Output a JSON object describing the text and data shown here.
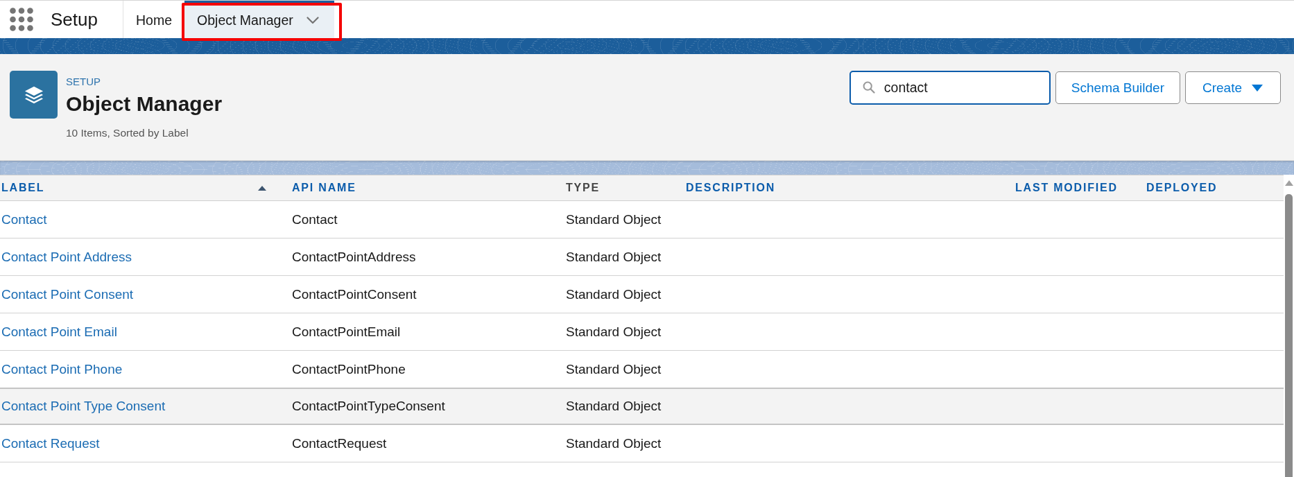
{
  "app_bar": {
    "app_name": "Setup",
    "tabs": [
      {
        "label": "Home",
        "selected": false,
        "has_menu": false,
        "annotated": false
      },
      {
        "label": "Object Manager",
        "selected": true,
        "has_menu": true,
        "annotated": true
      }
    ]
  },
  "page_header": {
    "breadcrumb": "SETUP",
    "title": "Object Manager",
    "summary": "10 Items, Sorted by Label",
    "search": {
      "value": "contact"
    },
    "buttons": [
      {
        "label": "Schema Builder",
        "kind": "plain"
      },
      {
        "label": "Create",
        "kind": "dropdown"
      }
    ]
  },
  "table": {
    "columns": [
      {
        "label": "LABEL",
        "sortable": true,
        "sorted": true
      },
      {
        "label": "API NAME",
        "sortable": true,
        "sorted": false
      },
      {
        "label": "TYPE",
        "sortable": false,
        "sorted": false
      },
      {
        "label": "DESCRIPTION",
        "sortable": true,
        "sorted": false
      },
      {
        "label": "LAST MODIFIED",
        "sortable": true,
        "sorted": false
      },
      {
        "label": "DEPLOYED",
        "sortable": true,
        "sorted": false
      }
    ],
    "rows": [
      {
        "label": "Contact",
        "api_name": "Contact",
        "type": "Standard Object",
        "hovered": false
      },
      {
        "label": "Contact Point Address",
        "api_name": "ContactPointAddress",
        "type": "Standard Object",
        "hovered": false
      },
      {
        "label": "Contact Point Consent",
        "api_name": "ContactPointConsent",
        "type": "Standard Object",
        "hovered": false
      },
      {
        "label": "Contact Point Email",
        "api_name": "ContactPointEmail",
        "type": "Standard Object",
        "hovered": false
      },
      {
        "label": "Contact Point Phone",
        "api_name": "ContactPointPhone",
        "type": "Standard Object",
        "hovered": false
      },
      {
        "label": "Contact Point Type Consent",
        "api_name": "ContactPointTypeConsent",
        "type": "Standard Object",
        "hovered": true
      },
      {
        "label": "Contact Request",
        "api_name": "ContactRequest",
        "type": "Standard Object",
        "hovered": false
      }
    ]
  }
}
